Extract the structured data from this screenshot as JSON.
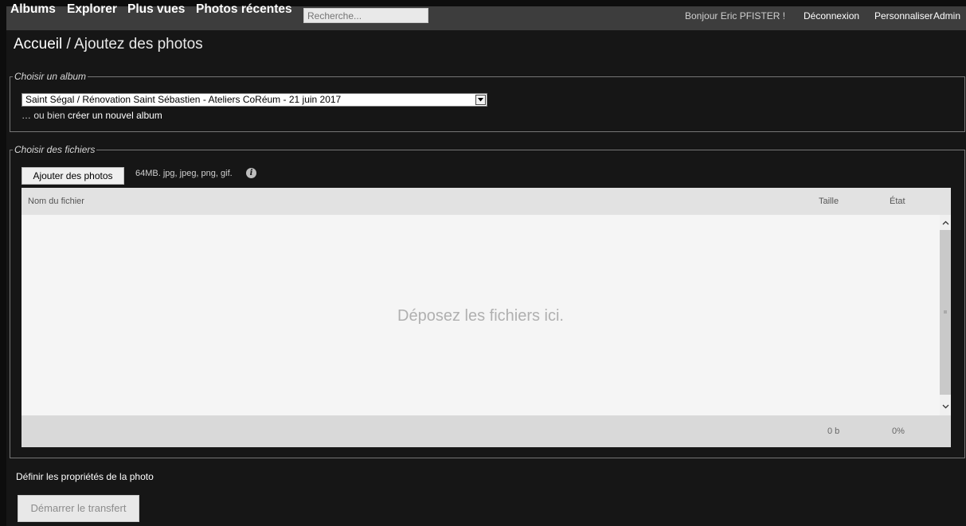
{
  "nav": {
    "items": [
      "Albums",
      "Explorer",
      "Plus vues",
      "Photos récentes"
    ],
    "search_placeholder": "Recherche...",
    "greeting": "Bonjour Eric PFISTER !",
    "logout": "Déconnexion",
    "customize": "Personnaliser",
    "admin": "Admin"
  },
  "breadcrumb": {
    "home": "Accueil",
    "separator": " / ",
    "current": "Ajoutez des photos"
  },
  "album_section": {
    "legend": "Choisir un album",
    "selected_album": "Saint Ségal / Rénovation Saint Sébastien - Ateliers CoRéum - 21 juin 2017",
    "create_prefix": "… ou bien ",
    "create_link": "créer un nouvel album"
  },
  "files_section": {
    "legend": "Choisir des fichiers",
    "add_button": "Ajouter des photos",
    "formats_hint": "64MB. jpg, jpeg, png, gif.",
    "columns": {
      "filename": "Nom du fichier",
      "size": "Taille",
      "status": "État"
    },
    "drop_text": "Déposez les fichiers ici.",
    "total_size": "0 b",
    "total_progress": "0%"
  },
  "define_properties": "Définir les propriétés de la photo",
  "start_button": "Démarrer le transfert",
  "colors": {
    "page_bg": "#0d0d0d",
    "topbar_bg": "#3d3d3d",
    "uploader_bg": "#f5f5f5"
  }
}
